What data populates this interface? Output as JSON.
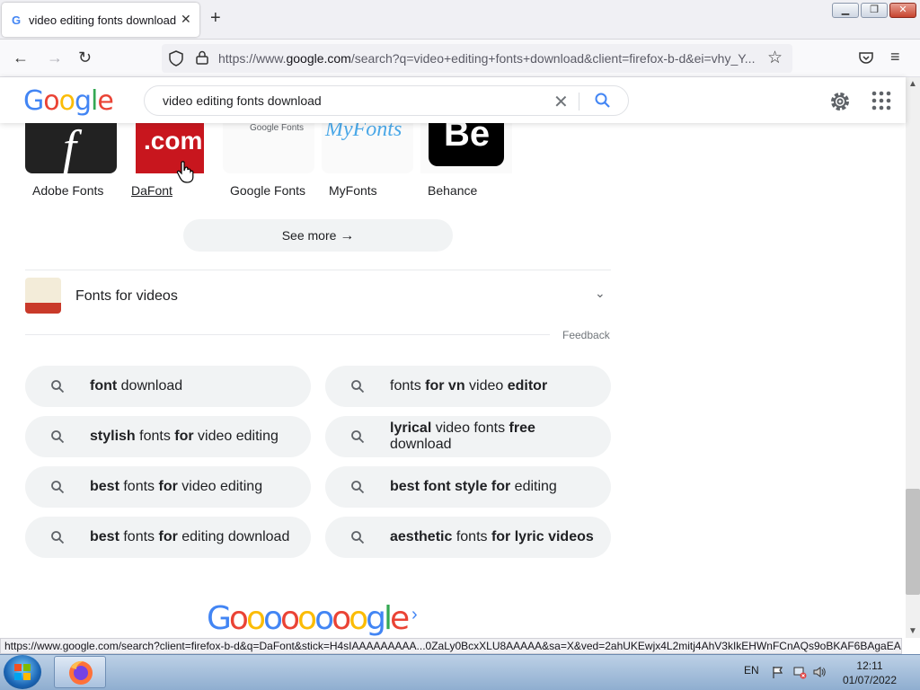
{
  "browser": {
    "tab_title": "video editing fonts download -",
    "url_prefix": "https://www.",
    "url_domain": "google.com",
    "url_rest": "/search?q=video+editing+fonts+download&client=firefox-b-d&ei=vhy_Y...",
    "status_url": "https://www.google.com/search?client=firefox-b-d&q=DaFont&stick=H4sIAAAAAAAAA...0ZaLy0BcxXLU8AAAAA&sa=X&ved=2ahUKEwjx4L2mitj4AhV3kIkEHWnFCnAQs9oBKAF6BAgaEAM"
  },
  "search": {
    "logo": "Google",
    "query": "video editing fonts download"
  },
  "carousel": {
    "items": [
      {
        "label": "Adobe Fonts",
        "tile_text": "f"
      },
      {
        "label": "DaFont",
        "tile_text": ".com"
      },
      {
        "label": "Google Fonts",
        "tile_text": "Google Fonts"
      },
      {
        "label": "MyFonts",
        "tile_text": "MyFonts"
      },
      {
        "label": "Behance",
        "tile_text": "Be"
      }
    ],
    "see_more": "See more"
  },
  "section": {
    "title": "Fonts for videos",
    "feedback": "Feedback"
  },
  "related": [
    {
      "plain_before": "",
      "bold": "font",
      "plain_after": " download"
    },
    {
      "html": "fonts <b>for vn</b> video <b>editor</b>",
      "text": "fonts for vn video editor"
    },
    {
      "text": "stylish fonts for video editing"
    },
    {
      "text": "lyrical video fonts free download"
    },
    {
      "text": "best fonts for video editing"
    },
    {
      "text": "best font style for editing"
    },
    {
      "text": "best fonts for editing download"
    },
    {
      "text": "aesthetic fonts for lyric videos"
    }
  ],
  "pagination": {
    "logo": "Goooooooogle"
  },
  "taskbar": {
    "lang": "EN",
    "time": "12:11",
    "date": "01/07/2022"
  },
  "colors": {
    "google_blue": "#4285f4",
    "google_red": "#ea4335",
    "google_yellow": "#fbbc05",
    "google_green": "#34a853"
  }
}
